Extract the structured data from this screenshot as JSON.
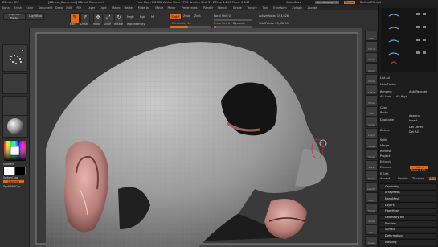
{
  "titlebar": {
    "app": "ZBrush 4R7",
    "file": "[ZBrush_Document] ZBrush Document",
    "stats": "Free Mem 1.87GB  Active Mem 1750  Scratch Disk 21  ZTime 1.213  Timer 0.043",
    "menus_label": "Menus",
    "default_script": "DefaultZScript",
    "quicksave": "QuickSave",
    "see_through": "See-through 0"
  },
  "menubar": [
    "Alpha",
    "Brush",
    "Color",
    "Document",
    "Draw",
    "Edit",
    "File",
    "Layer",
    "Light",
    "Macro",
    "Marker",
    "Material",
    "Movie",
    "Picker",
    "Preferences",
    "Render",
    "Stencil",
    "Stroke",
    "Texture",
    "Tool",
    "Transform",
    "Zplugin",
    "Zscript"
  ],
  "toolbar": {
    "projection_master": "Projection Master",
    "lightbox": "LightBox",
    "edit": "Edit",
    "draw": "Draw",
    "move": "Move",
    "scale": "Scale",
    "rotate": "Rotate",
    "mrgb": "Mrgb",
    "rgb": "Rgb",
    "m": "M",
    "zadd": "Zadd",
    "zsub": "Zsub",
    "zcut": "Zcut",
    "rgb_intensity": "Rgb Intensity",
    "z_intensity": "Z Intensity 43",
    "z_intensity_level": 0.43,
    "focal_shift": "Focal Shift 0",
    "draw_size": "Draw Size 6",
    "draw_size_level": 0.06,
    "active_points": "ActivePoints: 193,028",
    "total_points": "TotalPoints: 20,838 Mil",
    "dynamic": "Dynamic"
  },
  "left_shelf": {
    "gradient_label": "Gradient",
    "switch_color": "SwitchColor",
    "alternate": "Alternate",
    "synth_matcap": "SynthMatCap",
    "main_color": "#ffffff",
    "secondary_color": "#000000"
  },
  "right_shelf": [
    "BPR",
    "SPix 3",
    "Scroll",
    "Zoom",
    "Actual",
    "AAHalf",
    "Persp",
    "Floor",
    "Local",
    "L.Sym",
    "Frame",
    "Move",
    "Scale",
    "Rotate",
    "Line Fill",
    "PolyF",
    "Transp",
    "Ghost",
    "Solo",
    "Xpose"
  ],
  "panel": {
    "list_all": "List All",
    "new_folder": "New Folder",
    "rename": "Rename",
    "autoreorder": "AutoReorder",
    "all_low": "All Low",
    "all_high": "All High",
    "copy": "Copy",
    "paste": "Paste",
    "duplicate": "Duplicate",
    "append": "Append",
    "insert": "Insert",
    "delete": "Delete",
    "del_other": "Del Other",
    "del_all": "Del All",
    "split": "Split",
    "merge": "Merge",
    "remesh": "Remesh",
    "project": "Project",
    "extract": "Extract",
    "extract_sub": "Extract",
    "s_smt": "S Smt 5",
    "thick": "Thick 0.02",
    "e_smt": "E Smt",
    "accept": "Accept",
    "double": "Double",
    "tcorner": "TCorner",
    "tborder": "TBorder",
    "subpalettes": [
      "Geometry",
      "ArrayMesh",
      "NanoMesh",
      "Layers",
      "FiberMesh",
      "Geometry HD",
      "Preview",
      "Surface",
      "Deformation",
      "Masking"
    ]
  },
  "colors": {
    "accent": "#e06a1a",
    "skin": "#c48a86",
    "clay": "#9a9a9a"
  }
}
